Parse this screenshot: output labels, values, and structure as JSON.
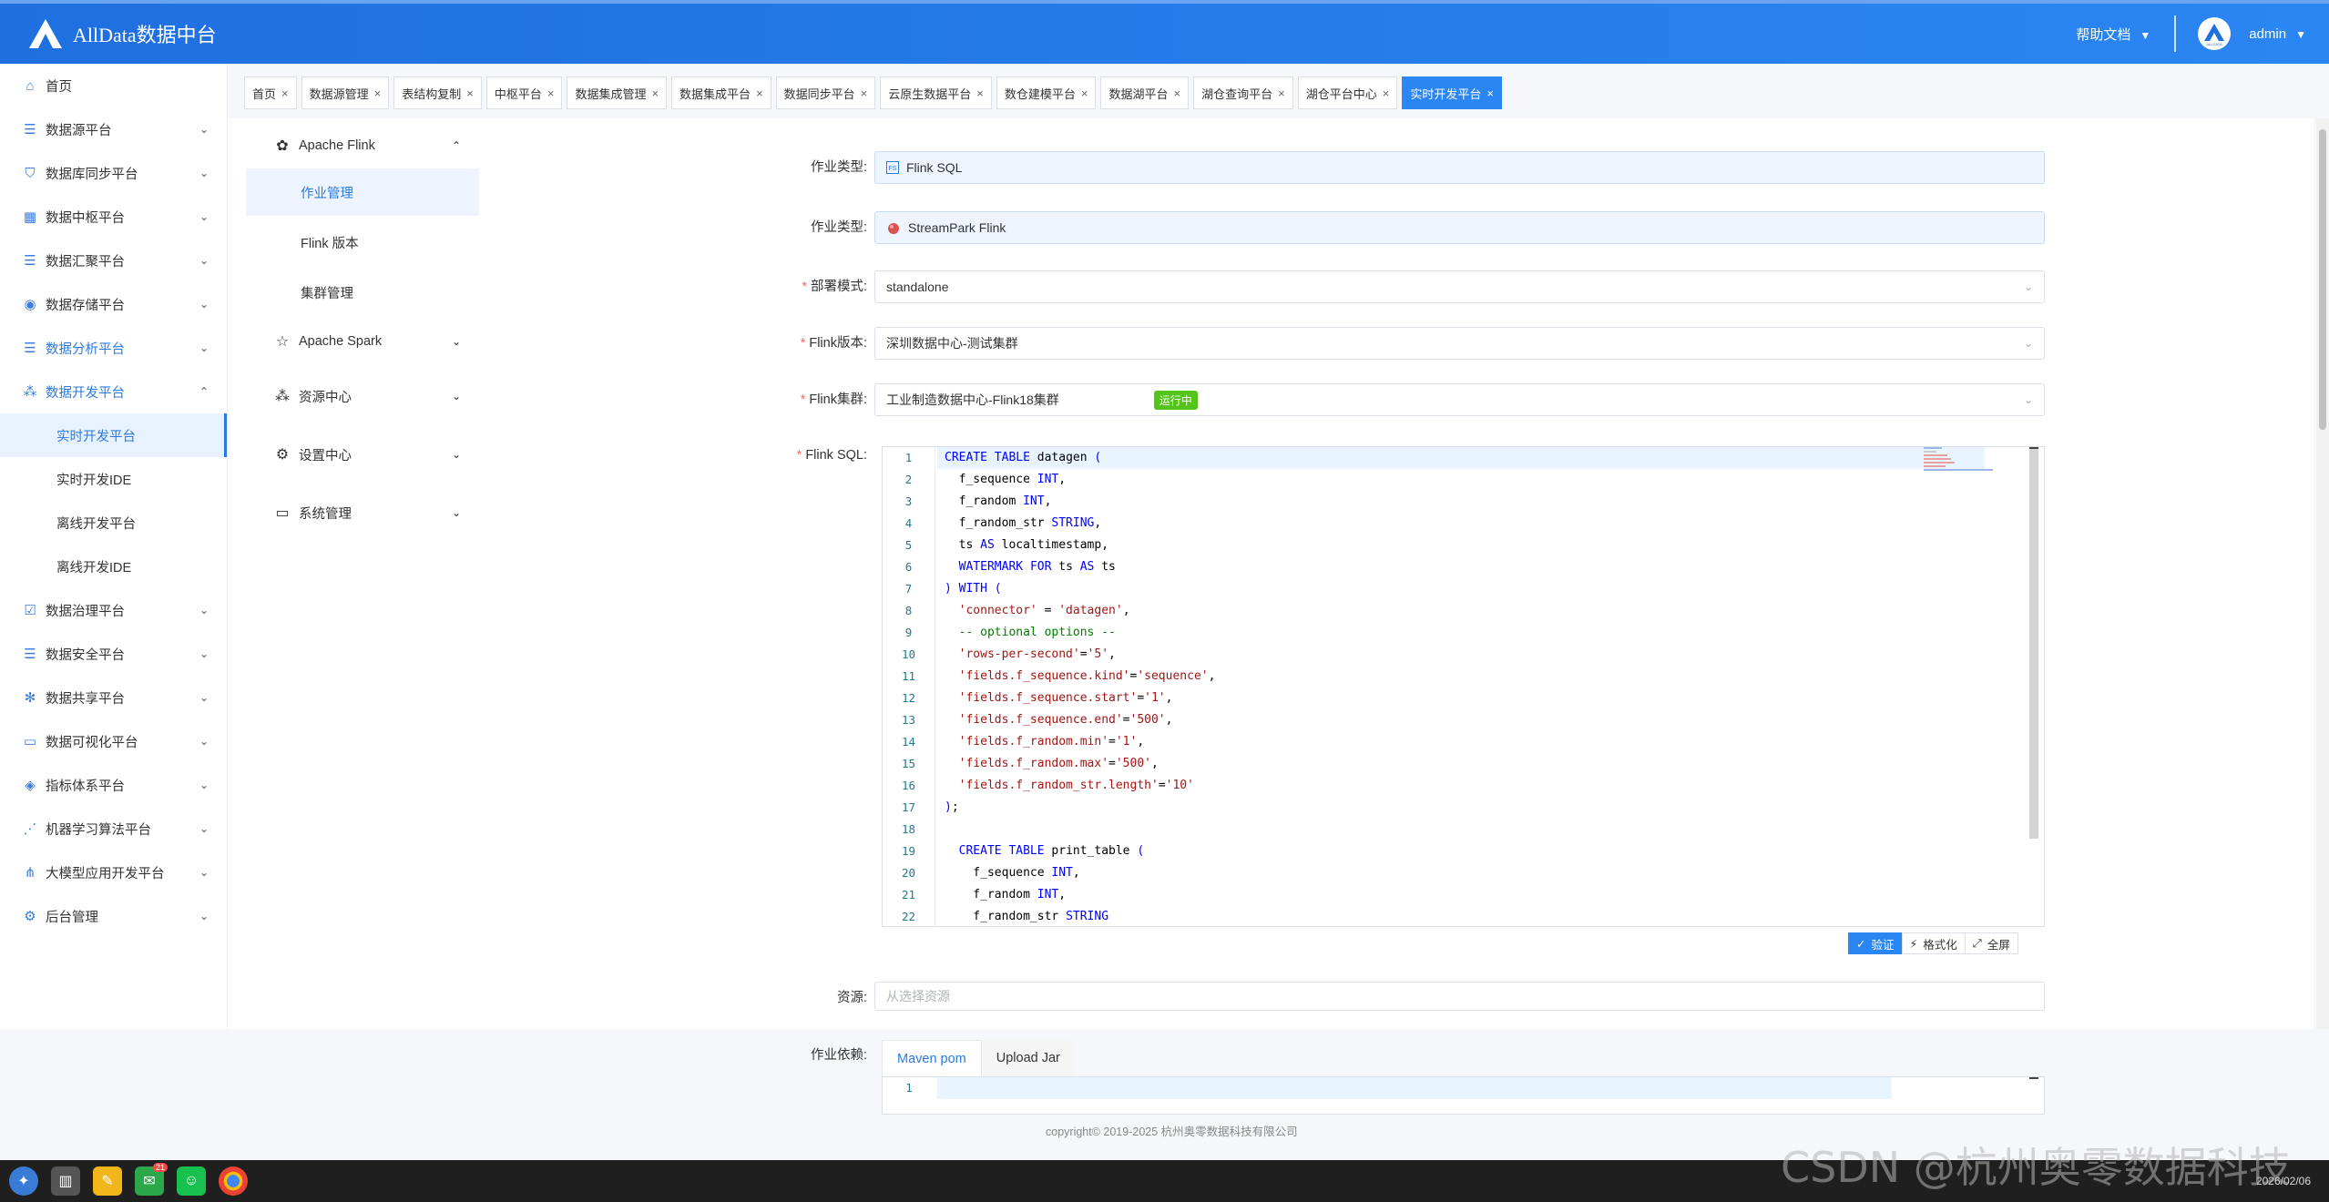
{
  "header": {
    "app_title": "AllData数据中台",
    "help_label": "帮助文档",
    "user_name": "admin",
    "avatar_text": "ALLDATA"
  },
  "sidebar": {
    "items": [
      {
        "label": "首页",
        "icon": "home-icon",
        "chevron": false
      },
      {
        "label": "数据源平台",
        "icon": "database-icon",
        "chevron": true
      },
      {
        "label": "数据库同步平台",
        "icon": "shield-icon",
        "chevron": true
      },
      {
        "label": "数据中枢平台",
        "icon": "grid-icon",
        "chevron": true
      },
      {
        "label": "数据汇聚平台",
        "icon": "database-icon",
        "chevron": true
      },
      {
        "label": "数据存储平台",
        "icon": "chart-icon",
        "chevron": true
      },
      {
        "label": "数据分析平台",
        "icon": "database-icon",
        "chevron": true
      },
      {
        "label": "数据开发平台",
        "icon": "apps-icon",
        "chevron": true
      }
    ],
    "dev_children": [
      "实时开发平台",
      "实时开发IDE",
      "离线开发平台",
      "离线开发IDE"
    ],
    "items_after": [
      {
        "label": "数据治理平台",
        "icon": "check-square-icon"
      },
      {
        "label": "数据安全平台",
        "icon": "database-icon"
      },
      {
        "label": "数据共享平台",
        "icon": "snowflake-icon"
      },
      {
        "label": "数据可视化平台",
        "icon": "monitor-icon"
      },
      {
        "label": "指标体系平台",
        "icon": "cube-icon"
      },
      {
        "label": "机器学习算法平台",
        "icon": "network-icon"
      },
      {
        "label": "大模型应用开发平台",
        "icon": "share-icon"
      },
      {
        "label": "后台管理",
        "icon": "settings-icon"
      }
    ]
  },
  "tabs": [
    {
      "label": "首页",
      "active": false
    },
    {
      "label": "数据源管理",
      "active": false
    },
    {
      "label": "表结构复制",
      "active": false
    },
    {
      "label": "中枢平台",
      "active": false
    },
    {
      "label": "数据集成管理",
      "active": false
    },
    {
      "label": "数据集成平台",
      "active": false
    },
    {
      "label": "数据同步平台",
      "active": false
    },
    {
      "label": "云原生数据平台",
      "active": false
    },
    {
      "label": "数仓建模平台",
      "active": false
    },
    {
      "label": "数据湖平台",
      "active": false
    },
    {
      "label": "湖仓查询平台",
      "active": false
    },
    {
      "label": "湖仓平台中心",
      "active": false
    },
    {
      "label": "实时开发平台",
      "active": true
    }
  ],
  "submenu": {
    "flink_label": "Apache Flink",
    "flink_items": [
      "作业管理",
      "Flink 版本",
      "集群管理"
    ],
    "spark_label": "Apache Spark",
    "resource_label": "资源中心",
    "settings_label": "设置中心",
    "system_label": "系统管理"
  },
  "form": {
    "job_type_label": "作业类型:",
    "job_type_value": "Flink SQL",
    "job_type2_label": "作业类型:",
    "job_type2_value": "StreamPark Flink",
    "deploy_label": "部署模式:",
    "deploy_value": "standalone",
    "flink_version_label": "Flink版本:",
    "flink_version_value": "深圳数据中心-测试集群",
    "flink_cluster_label": "Flink集群:",
    "flink_cluster_value": "工业制造数据中心-Flink18集群",
    "cluster_status": "运行中",
    "sql_label": "Flink SQL:",
    "resource_label": "资源:",
    "resource_placeholder": "从选择资源",
    "dependency_label": "作业依赖:"
  },
  "editor": {
    "lines": [
      "CREATE TABLE datagen (",
      "  f_sequence INT,",
      "  f_random INT,",
      "  f_random_str STRING,",
      "  ts AS localtimestamp,",
      "  WATERMARK FOR ts AS ts",
      ") WITH (",
      "  'connector' = 'datagen',",
      "  -- optional options --",
      "  'rows-per-second'='5',",
      "  'fields.f_sequence.kind'='sequence',",
      "  'fields.f_sequence.start'='1',",
      "  'fields.f_sequence.end'='500',",
      "  'fields.f_random.min'='1',",
      "  'fields.f_random.max'='500',",
      "  'fields.f_random_str.length'='10'",
      ");",
      "",
      "  CREATE TABLE print_table (",
      "    f_sequence INT,",
      "    f_random INT,",
      "    f_random_str STRING"
    ],
    "verify_label": "验证",
    "format_label": "格式化",
    "fullscreen_label": "全屏"
  },
  "dependency": {
    "tab_maven": "Maven pom",
    "tab_jar": "Upload Jar",
    "line_number": "1"
  },
  "footer": {
    "copyright": "copyright© 2019-2025 杭州奥零数据科技有限公司"
  },
  "taskbar": {
    "badge_count": "21",
    "date": "2026/02/06"
  },
  "watermark": "CSDN @杭州奥零数据科技",
  "colors": {
    "primary": "#2a86f3",
    "required": "#f56c6c",
    "running": "#52c41a"
  }
}
